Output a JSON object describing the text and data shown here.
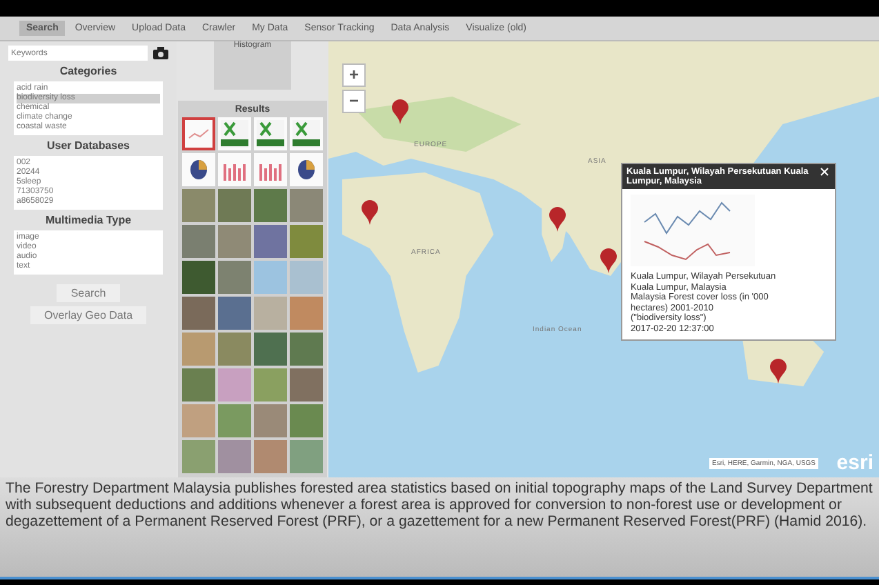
{
  "tabs": [
    {
      "label": "Search",
      "selected": true
    },
    {
      "label": "Overview",
      "selected": false
    },
    {
      "label": "Upload Data",
      "selected": false
    },
    {
      "label": "Crawler",
      "selected": false
    },
    {
      "label": "My Data",
      "selected": false
    },
    {
      "label": "Sensor Tracking",
      "selected": false
    },
    {
      "label": "Data Analysis",
      "selected": false
    },
    {
      "label": "Visualize (old)",
      "selected": false
    }
  ],
  "search": {
    "placeholder": "Keywords"
  },
  "categories": {
    "title": "Categories",
    "items": [
      {
        "label": "acid rain",
        "selected": false
      },
      {
        "label": "biodiversity loss",
        "selected": true
      },
      {
        "label": "chemical",
        "selected": false
      },
      {
        "label": "climate change",
        "selected": false
      },
      {
        "label": "coastal waste",
        "selected": false
      }
    ]
  },
  "user_databases": {
    "title": "User Databases",
    "items": [
      {
        "label": "002",
        "selected": false
      },
      {
        "label": "20244",
        "selected": false
      },
      {
        "label": "5sleep",
        "selected": false
      },
      {
        "label": "71303750",
        "selected": false
      },
      {
        "label": "a8658029",
        "selected": false
      }
    ]
  },
  "multimedia_type": {
    "title": "Multimedia Type",
    "items": [
      {
        "label": "image",
        "selected": false
      },
      {
        "label": "video",
        "selected": false
      },
      {
        "label": "audio",
        "selected": false
      },
      {
        "label": "text",
        "selected": false
      }
    ]
  },
  "buttons": [
    "Search",
    "Overlay Geo Data"
  ],
  "histogram": {
    "label": "Histogram"
  },
  "results": {
    "title": "Results",
    "thumbnails": [
      {
        "kind": "chart",
        "selected": true
      },
      {
        "kind": "sheet",
        "selected": false
      },
      {
        "kind": "sheet",
        "selected": false
      },
      {
        "kind": "sheet",
        "selected": false
      },
      {
        "kind": "pie",
        "selected": false
      },
      {
        "kind": "bars",
        "selected": false
      },
      {
        "kind": "bars",
        "selected": false
      },
      {
        "kind": "pie",
        "selected": false
      },
      {
        "kind": "photo",
        "selected": false
      },
      {
        "kind": "photo",
        "selected": false
      },
      {
        "kind": "photo",
        "selected": false
      },
      {
        "kind": "photo",
        "selected": false
      },
      {
        "kind": "photo",
        "selected": false
      },
      {
        "kind": "photo",
        "selected": false
      },
      {
        "kind": "photo",
        "selected": false
      },
      {
        "kind": "photo",
        "selected": false
      },
      {
        "kind": "photo",
        "selected": false
      },
      {
        "kind": "photo",
        "selected": false
      },
      {
        "kind": "photo",
        "selected": false
      },
      {
        "kind": "photo",
        "selected": false
      },
      {
        "kind": "photo",
        "selected": false
      },
      {
        "kind": "photo",
        "selected": false
      },
      {
        "kind": "photo",
        "selected": false
      },
      {
        "kind": "photo",
        "selected": false
      },
      {
        "kind": "photo",
        "selected": false
      },
      {
        "kind": "photo",
        "selected": false
      },
      {
        "kind": "photo",
        "selected": false
      },
      {
        "kind": "photo",
        "selected": false
      },
      {
        "kind": "photo",
        "selected": false
      },
      {
        "kind": "photo",
        "selected": false
      },
      {
        "kind": "photo",
        "selected": false
      },
      {
        "kind": "photo",
        "selected": false
      },
      {
        "kind": "photo",
        "selected": false
      },
      {
        "kind": "photo",
        "selected": false
      },
      {
        "kind": "photo",
        "selected": false
      },
      {
        "kind": "photo",
        "selected": false
      },
      {
        "kind": "photo",
        "selected": false
      },
      {
        "kind": "photo",
        "selected": false
      },
      {
        "kind": "photo",
        "selected": false
      },
      {
        "kind": "photo",
        "selected": false
      }
    ]
  },
  "map": {
    "zoom_in": "+",
    "zoom_out": "−",
    "labels": [
      "EUROPE",
      "ASIA",
      "AFRICA",
      "Indian Ocean"
    ],
    "popup": {
      "title": "Kuala Lumpur, Wilayah Persekutuan Kuala Lumpur, Malaysia",
      "lines": [
        "Kuala Lumpur, Wilayah Persekutuan",
        "Kuala Lumpur, Malaysia",
        "Malaysia Forest cover loss (in '000",
        "hectares) 2001-2010",
        "(\"biodiversity loss\")",
        "2017-02-20 12:37:00"
      ]
    },
    "attribution": "Esri, HERE, Garmin, NGA, USGS",
    "logo": "esri"
  },
  "caption": "The Forestry Department Malaysia publishes forested area statistics based on initial topography maps of the Land Survey Department with subsequent deductions and additions whenever a forest area is approved for conversion to non-forest use or development or degazettement of a Permanent Reserved Forest (PRF), or a gazettement for a new Permanent Reserved Forest(PRF) (Hamid 2016)."
}
